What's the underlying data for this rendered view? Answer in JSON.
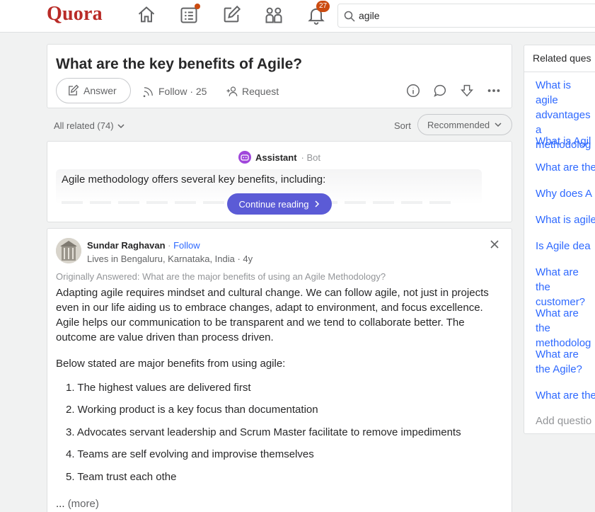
{
  "header": {
    "logo": "Quora",
    "notifications_count": "27",
    "search_value": "agile"
  },
  "question": {
    "title": "What are the key benefits of Agile?",
    "answer_label": "Answer",
    "follow_label": "Follow · 25",
    "request_label": "Request"
  },
  "filters": {
    "all_related": "All related (74)",
    "sort_label": "Sort",
    "sort_value": "Recommended"
  },
  "assistant": {
    "name": "Assistant",
    "bot_tag": "· Bot",
    "preview": "Agile methodology offers several key benefits, including:",
    "continue_label": "Continue reading"
  },
  "answer": {
    "author": "Sundar Raghavan",
    "follow": "Follow",
    "credential": "Lives in Bengaluru, Karnataka, India · 4y",
    "originally": "Originally Answered: What are the major benefits of using an Agile Methodology?",
    "paragraph1": "Adapting agile requires mindset and cultural change. We can follow agile, not just in projects even in our life aiding us to embrace changes, adapt to environment, and focus excellence. Agile helps our communication to be transparent and we tend to collaborate better. The outcome are value driven than process driven.",
    "paragraph2": "Below stated are major benefits from using agile:",
    "list": [
      "1. The highest values are delivered first",
      "2. Working product is a key focus than documentation",
      "3. Advocates servant leadership and Scrum Master facilitate to remove impediments",
      "4. Teams are self evolving and improvise themselves",
      "5. Team trust each othe"
    ],
    "ellipsis": "...",
    "more": "(more)"
  },
  "sidebar": {
    "heading": "Related ques",
    "links": [
      "What is agile advantages a methodolog",
      "What is Agil",
      "What are the",
      "Why does A",
      "What is agile",
      "Is Agile dea",
      "What are the customer?",
      "What are the methodolog",
      "What are the Agile?",
      "What are the"
    ],
    "add_question": "Add questio"
  }
}
